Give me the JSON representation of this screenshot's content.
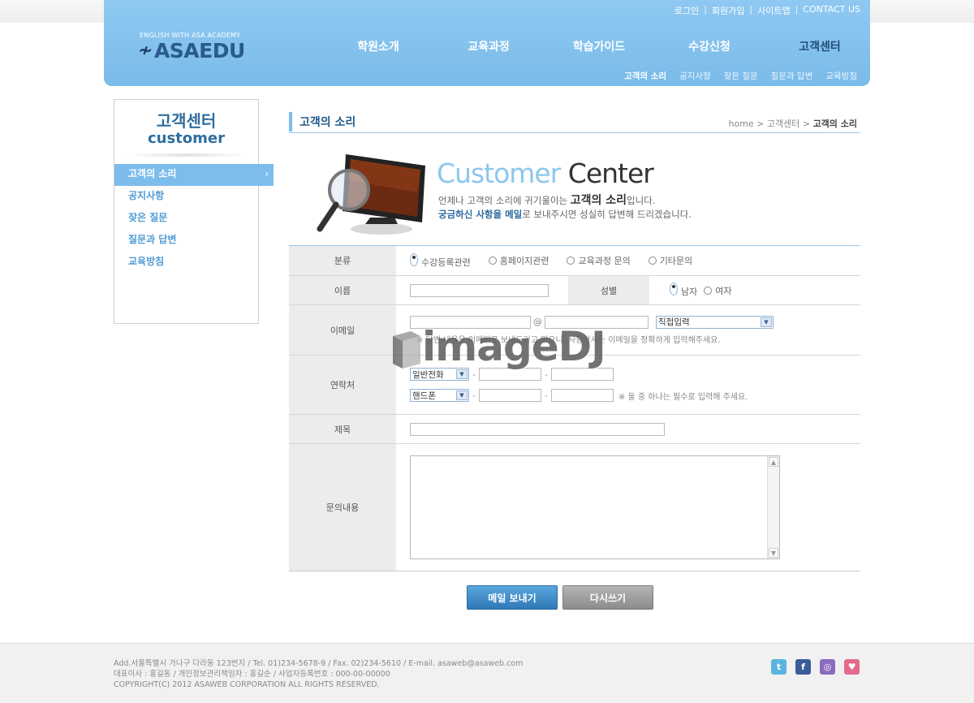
{
  "util_links": [
    "로그인",
    "회원가입",
    "사이트맵",
    "CONTACT US"
  ],
  "logo": {
    "sub": "ENGLISH WITH ASA ACADEMY",
    "name": "ASAEDU"
  },
  "gnb": [
    "학원소개",
    "교육과정",
    "학습가이드",
    "수강신청",
    "고객센터"
  ],
  "lnb": [
    "고객의 소리",
    "공지사항",
    "잦은 질문",
    "질문과 답변",
    "교육방침"
  ],
  "sidebar": {
    "title_ko": "고객센터",
    "title_en": "customer",
    "items": [
      "고객의 소리",
      "공지사항",
      "잦은 질문",
      "질문과 답변",
      "교육방침"
    ],
    "arrow": "›"
  },
  "content": {
    "title": "고객의 소리",
    "breadcrumb": {
      "home": "home",
      "parent": "고객센터",
      "current": "고객의 소리",
      "sep": ">"
    }
  },
  "hero": {
    "title_a": "Customer",
    "title_b": "Center",
    "line1_a": "언제나 고객의 소리에 귀기울이는",
    "line1_b": "고객의 소리",
    "line1_c": "입니다.",
    "line2_a": "궁금하신 사항을 메일",
    "line2_b": "로 보내주시면 성실히 답변해 드리겠습니다."
  },
  "form": {
    "category": {
      "label": "분류",
      "options": [
        "수강등록관련",
        "홈페이지관련",
        "교육과정 문의",
        "기타문의"
      ]
    },
    "name": {
      "label": "이름"
    },
    "gender": {
      "label": "성별",
      "options": [
        "남자",
        "여자"
      ]
    },
    "email": {
      "label": "이메일",
      "at": "@",
      "select": "직접입력",
      "note": "※ 답변 내용은 이메일로 보내드리고 있으니, 사용하시는 이메일을 정확하게 입력해주세요."
    },
    "contact": {
      "label": "연락처",
      "phone_select": "일반전화",
      "mobile_select": "핸드폰",
      "dash": "-",
      "note": "※ 둘 중 하나는 필수로 입력해 주세요."
    },
    "subject": {
      "label": "제목"
    },
    "body": {
      "label": "문의내용"
    }
  },
  "buttons": {
    "send": "메일 보내기",
    "reset": "다시쓰기"
  },
  "watermark": "imageDJ",
  "footer": {
    "line1": "Add.서울특별시 가나구 다라동 123번지  / Tel. 01)234-5678-9  / Fax. 02)234-5610  / E-mail. asaweb@asaweb.com",
    "line2": "대표이사 : 홍길동 / 개인정보관리책임자 : 홍길순 / 사업자등록번호 : 000-00-00000",
    "line3": "COPYRIGHT(C) 2012 ASAWEB CORPORATION ALL RIGHTS RESERVED."
  },
  "social": {
    "twitter": "t",
    "facebook": "f",
    "me2day": "◎",
    "blog": "♥"
  },
  "colors": {
    "primary": "#7cbdec",
    "header": "#8fc9f2",
    "dark_blue": "#235c8b",
    "send_button": "#3f8ac8",
    "reset_button": "#9f9f9f"
  }
}
